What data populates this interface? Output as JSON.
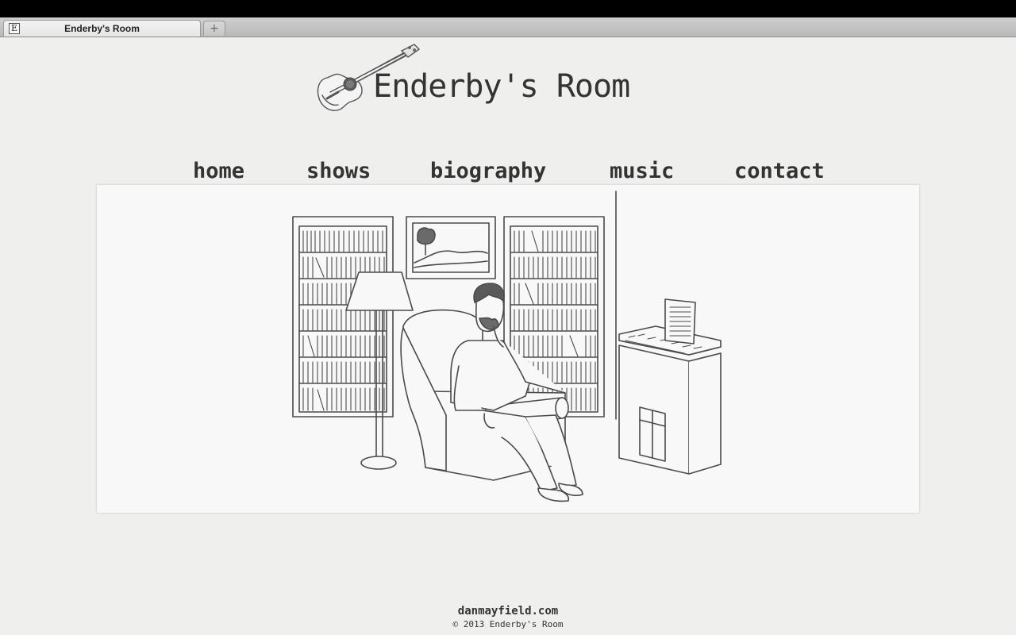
{
  "browser": {
    "tab_title": "Enderby's Room",
    "favicon_letter": "E",
    "new_tab_symbol": "+"
  },
  "header": {
    "site_title": "Enderby's Room",
    "logo_icon": "guitar-icon"
  },
  "nav": {
    "items": [
      {
        "label": "home"
      },
      {
        "label": "shows"
      },
      {
        "label": "biography"
      },
      {
        "label": "music"
      },
      {
        "label": "contact"
      }
    ]
  },
  "hero": {
    "illustration": "man-in-armchair-living-room-illustration"
  },
  "footer": {
    "link": "danmayfield.com",
    "copyright": "© 2013 Enderby's Room"
  }
}
